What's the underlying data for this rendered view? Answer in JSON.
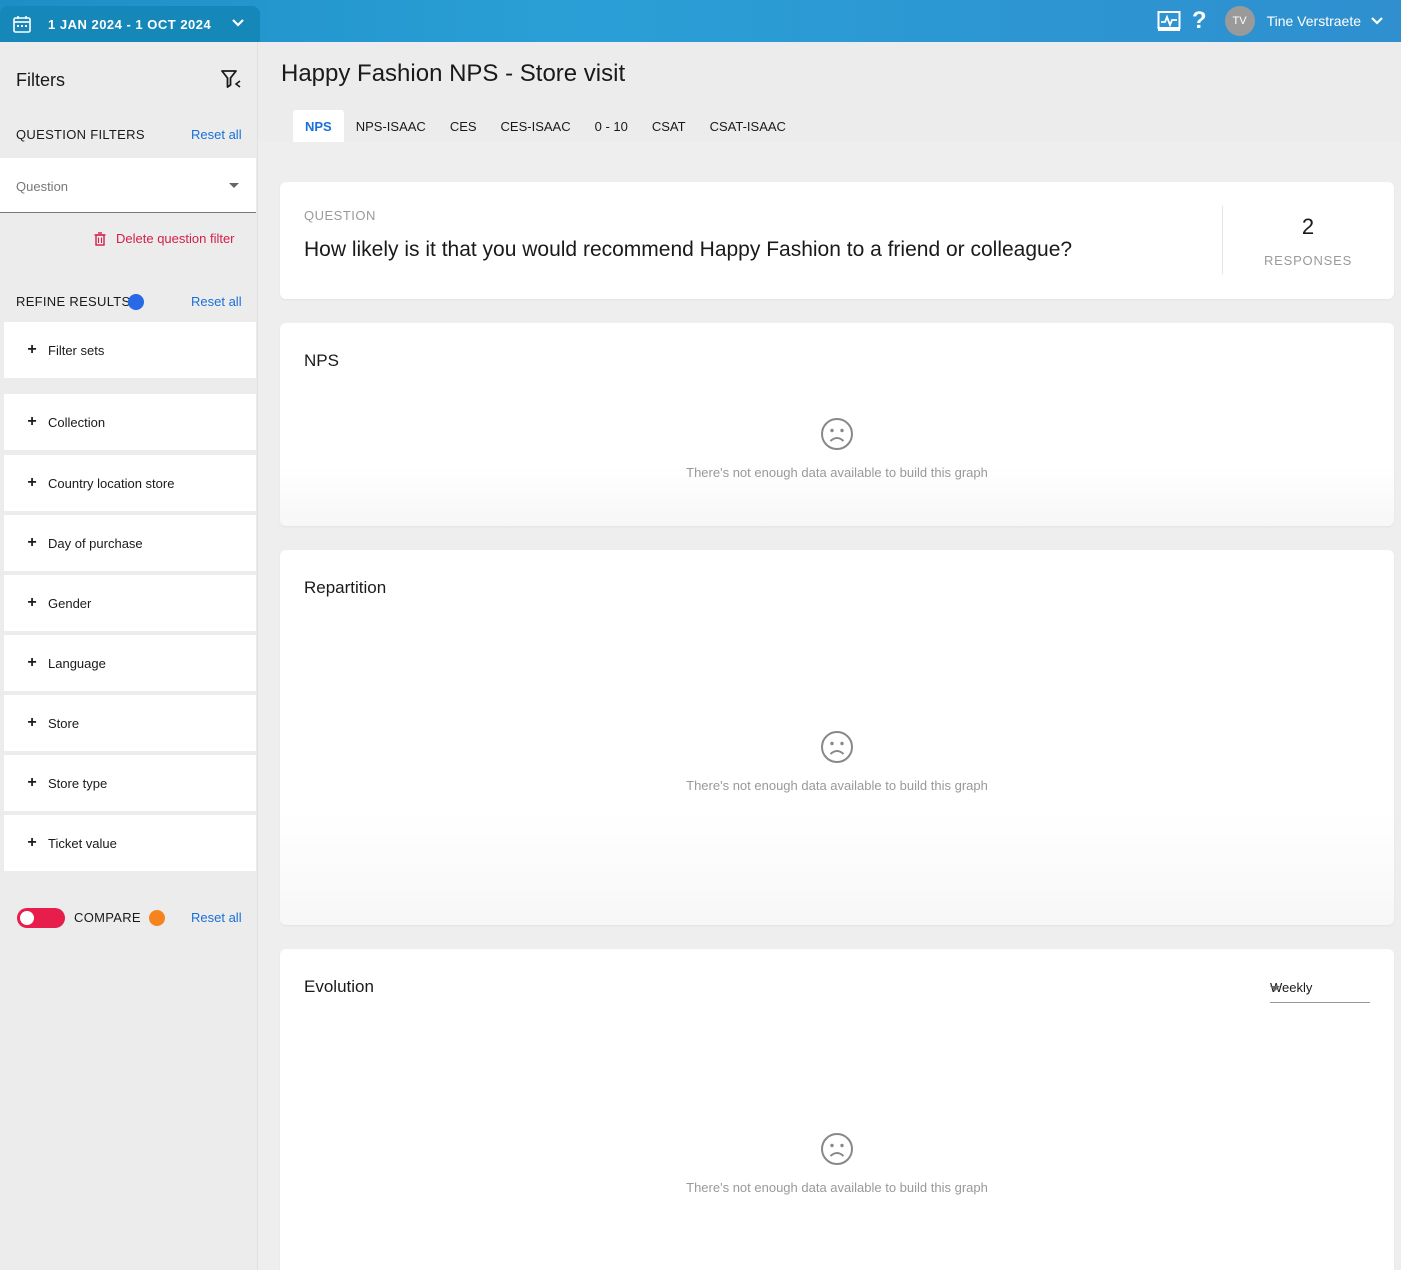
{
  "header": {
    "date_range": "1 JAN 2024 - 1 OCT 2024",
    "user_initials": "TV",
    "user_name": "Tine Verstraete",
    "help_label": "?"
  },
  "sidebar": {
    "title": "Filters",
    "question_filters": {
      "title": "QUESTION FILTERS",
      "reset": "Reset all",
      "question_placeholder": "Question",
      "delete_label": "Delete question filter"
    },
    "refine": {
      "title": "REFINE RESULTS",
      "reset": "Reset all",
      "items": [
        "Filter sets",
        "Collection",
        "Country location store",
        "Day of purchase",
        "Gender",
        "Language",
        "Store",
        "Store type",
        "Ticket value"
      ]
    },
    "compare": {
      "label": "COMPARE",
      "reset": "Reset all",
      "enabled": false
    }
  },
  "main": {
    "title": "Happy Fashion NPS - Store visit",
    "tabs": [
      "NPS",
      "NPS-ISAAC",
      "CES",
      "CES-ISAAC",
      "0 - 10",
      "CSAT",
      "CSAT-ISAAC"
    ],
    "active_tab": "NPS",
    "question_card": {
      "label": "QUESTION",
      "text": "How likely is it that you would recommend Happy Fashion to a friend or colleague?",
      "responses_count": "2",
      "responses_label": "RESPONSES"
    },
    "nps_card": {
      "title": "NPS",
      "empty_message": "There's not enough data available to build this graph"
    },
    "repartition_card": {
      "title": "Repartition",
      "empty_message": "There's not enough data available to build this graph"
    },
    "evolution_card": {
      "title": "Evolution",
      "interval": "Weekly",
      "empty_message": "There's not enough data available to build this graph"
    }
  },
  "colors": {
    "accent": "#1a6fd9",
    "danger": "#d3204a",
    "refine_dot": "#2769e6",
    "compare_dot": "#f5841f",
    "toggle": "#e71d4c"
  }
}
